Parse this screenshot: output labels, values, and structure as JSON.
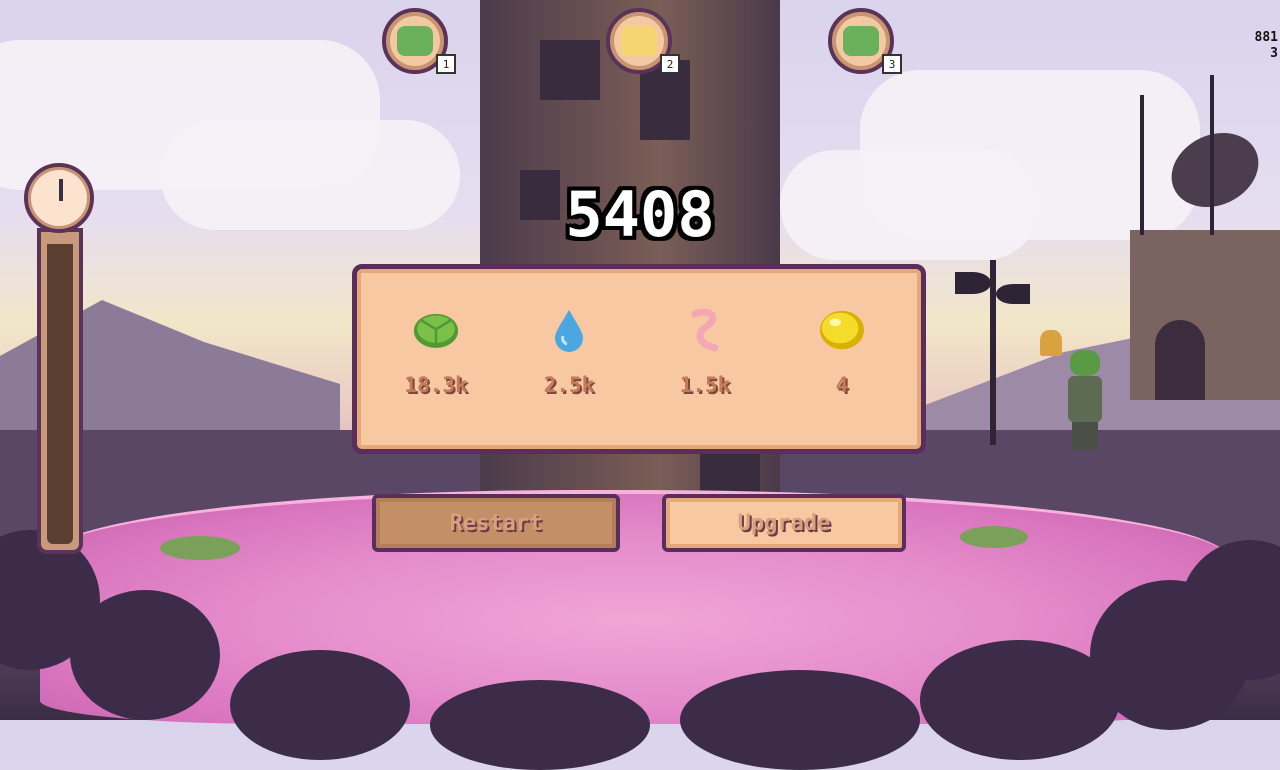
{
  "score": "5408",
  "leaderboard": [
    {
      "rank": "1",
      "icon": "frog-avatar-icon"
    },
    {
      "rank": "2",
      "icon": "sun-face-avatar-icon"
    },
    {
      "rank": "3",
      "icon": "frog-avatar-icon"
    }
  ],
  "corner_stats": {
    "line1": "881",
    "line2": "3"
  },
  "resources": [
    {
      "icon": "lily-pad-icon",
      "value": "18.3k"
    },
    {
      "icon": "water-drop-icon",
      "value": "2.5k"
    },
    {
      "icon": "worm-icon",
      "value": "1.5k"
    },
    {
      "icon": "coin-icon",
      "value": "4"
    }
  ],
  "buttons": {
    "restart": "Restart",
    "upgrade": "Upgrade"
  },
  "timer": {
    "icon": "clock-icon",
    "fill_fraction": 0.98
  },
  "colors": {
    "panel_bg": "#f7c8a2",
    "panel_border": "#5b2d5c",
    "pond": "#e58ccc",
    "score_text": "#ffffff"
  }
}
